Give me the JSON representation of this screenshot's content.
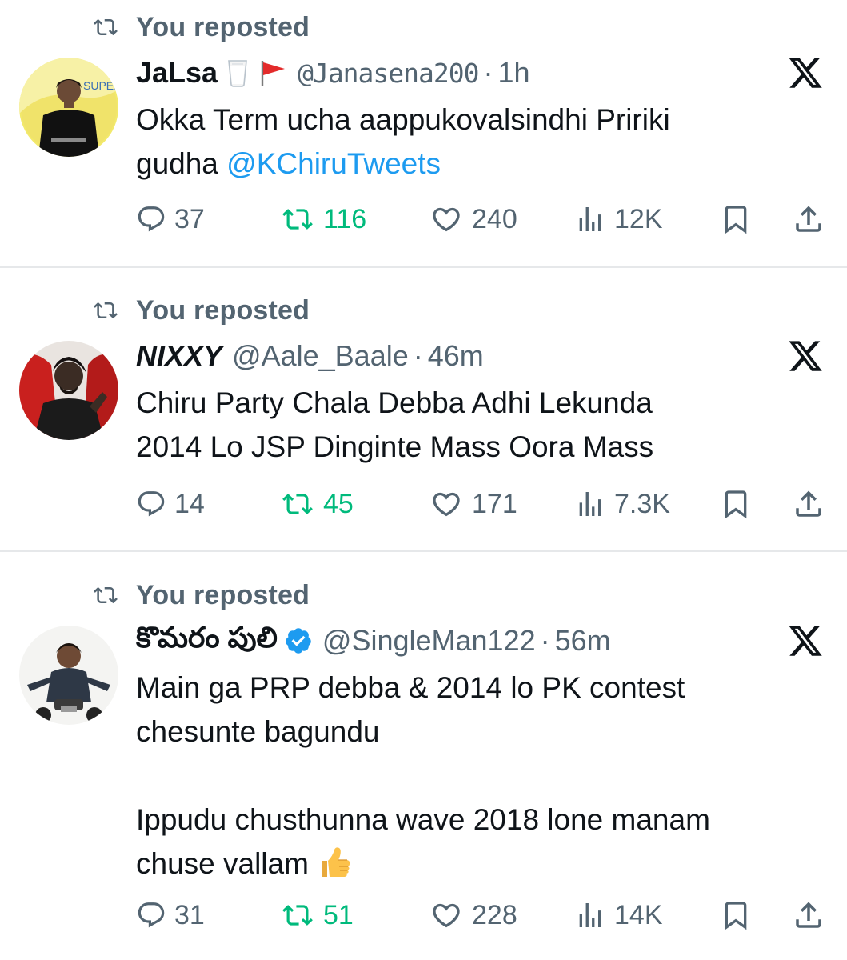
{
  "tweets": [
    {
      "repost_label": "You reposted",
      "display_name": "JaLsa",
      "handle": "@Janasena200",
      "separator": "·",
      "time": "1h",
      "text_lines": [
        "Okka Term ucha aappukovalsindhi Pririki",
        "gudha "
      ],
      "mention": "@KChiruTweets",
      "replies": "37",
      "reposts": "116",
      "likes": "240",
      "views": "12K",
      "emoji_icons": [
        "milk-glass-icon",
        "red-flag-icon"
      ]
    },
    {
      "repost_label": "You reposted",
      "display_name": "NIXXY",
      "handle": "@Aale_Baale",
      "separator": "·",
      "time": "46m",
      "text_lines": [
        "Chiru Party Chala Debba Adhi Lekunda",
        "2014 Lo JSP Dinginte Mass Oora Mass"
      ],
      "replies": "14",
      "reposts": "45",
      "likes": "171",
      "views": "7.3K"
    },
    {
      "repost_label": "You reposted",
      "display_name": "కొమరం పులి",
      "handle": "@SingleMan122",
      "separator": "·",
      "time": "56m",
      "text_lines": [
        "Main ga PRP debba & 2014 lo PK contest",
        "chesunte bagundu",
        "",
        "Ippudu chusthunna wave 2018 lone manam",
        "chuse vallam "
      ],
      "replies": "31",
      "reposts": "51",
      "likes": "228",
      "views": "14K",
      "emoji_icons": [
        "verified-badge-icon",
        "thumbs-up-icon"
      ]
    }
  ],
  "colors": {
    "text_primary": "#0f1419",
    "text_secondary": "#536471",
    "link_blue": "#1d9bf0",
    "repost_green": "#00ba7c",
    "divider": "#e6e8ea",
    "verified_blue": "#1d9bf0"
  }
}
